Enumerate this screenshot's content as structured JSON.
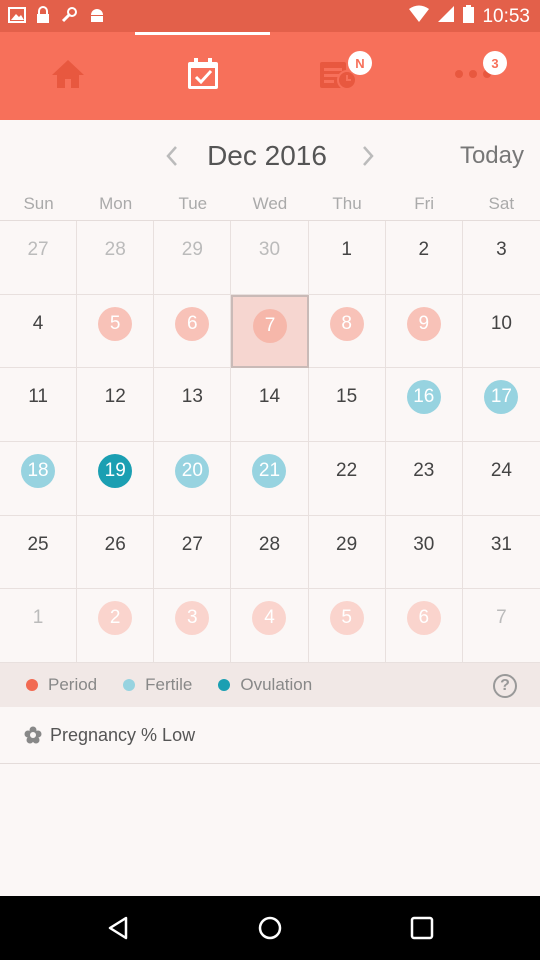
{
  "status_bar": {
    "time": "10:53"
  },
  "tabs": [
    {
      "name": "home",
      "icon": "home-icon"
    },
    {
      "name": "calendar",
      "icon": "calendar-check-icon"
    },
    {
      "name": "reminders",
      "icon": "calendar-clock-icon",
      "badge": "N"
    },
    {
      "name": "more",
      "icon": "more-dots-icon",
      "badge": "3"
    }
  ],
  "calendar": {
    "month_label": "Dec 2016",
    "today_label": "Today",
    "weekdays": [
      "Sun",
      "Mon",
      "Tue",
      "Wed",
      "Thu",
      "Fri",
      "Sat"
    ],
    "days": [
      {
        "d": "27",
        "out": true
      },
      {
        "d": "28",
        "out": true
      },
      {
        "d": "29",
        "out": true
      },
      {
        "d": "30",
        "out": true
      },
      {
        "d": "1"
      },
      {
        "d": "2"
      },
      {
        "d": "3"
      },
      {
        "d": "4"
      },
      {
        "d": "5",
        "type": "period"
      },
      {
        "d": "6",
        "type": "period"
      },
      {
        "d": "7",
        "type": "period",
        "selected": true
      },
      {
        "d": "8",
        "type": "period"
      },
      {
        "d": "9",
        "type": "period"
      },
      {
        "d": "10"
      },
      {
        "d": "11"
      },
      {
        "d": "12"
      },
      {
        "d": "13"
      },
      {
        "d": "14"
      },
      {
        "d": "15"
      },
      {
        "d": "16",
        "type": "fertile"
      },
      {
        "d": "17",
        "type": "fertile"
      },
      {
        "d": "18",
        "type": "fertile"
      },
      {
        "d": "19",
        "type": "ovulation"
      },
      {
        "d": "20",
        "type": "fertile"
      },
      {
        "d": "21",
        "type": "fertile"
      },
      {
        "d": "22"
      },
      {
        "d": "23"
      },
      {
        "d": "24"
      },
      {
        "d": "25"
      },
      {
        "d": "26"
      },
      {
        "d": "27"
      },
      {
        "d": "28"
      },
      {
        "d": "29"
      },
      {
        "d": "30"
      },
      {
        "d": "31"
      },
      {
        "d": "1",
        "out": true
      },
      {
        "d": "2",
        "out": true,
        "type": "period"
      },
      {
        "d": "3",
        "out": true,
        "type": "period"
      },
      {
        "d": "4",
        "out": true,
        "type": "period"
      },
      {
        "d": "5",
        "out": true,
        "type": "period"
      },
      {
        "d": "6",
        "out": true,
        "type": "period"
      },
      {
        "d": "7",
        "out": true
      }
    ]
  },
  "legend": {
    "period": {
      "label": "Period",
      "color": "#f26a52"
    },
    "fertile": {
      "label": "Fertile",
      "color": "#97d3e0"
    },
    "ovulation": {
      "label": "Ovulation",
      "color": "#1b9fb2"
    }
  },
  "pregnancy": {
    "label": "Pregnancy % Low"
  }
}
